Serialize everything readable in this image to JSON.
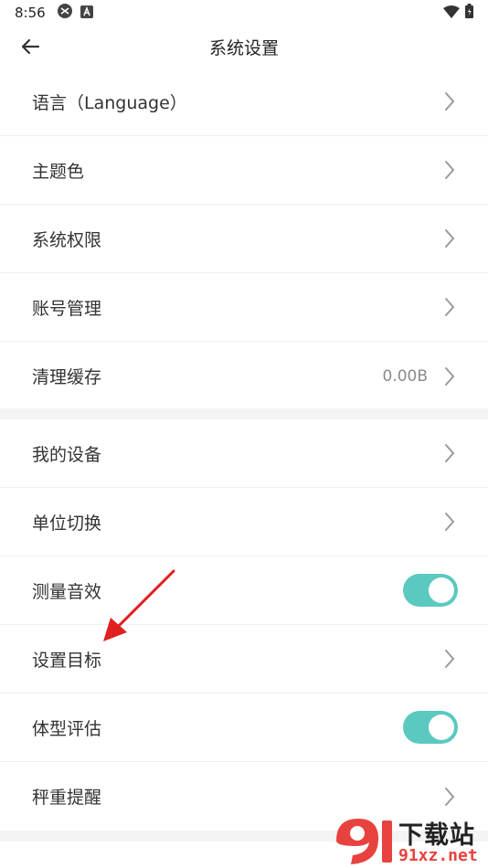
{
  "status_bar": {
    "time": "8:56"
  },
  "app_bar": {
    "title": "系统设置"
  },
  "group1": [
    {
      "label": "语言（Language）"
    },
    {
      "label": "主题色"
    },
    {
      "label": "系统权限"
    },
    {
      "label": "账号管理"
    },
    {
      "label": "清理缓存",
      "value": "0.00B"
    }
  ],
  "group2": [
    {
      "label": "我的设备"
    },
    {
      "label": "单位切换"
    },
    {
      "label": "测量音效",
      "toggle_on": true
    },
    {
      "label": "设置目标"
    },
    {
      "label": "体型评估",
      "toggle_on": true
    },
    {
      "label": "秤重提醒"
    }
  ],
  "colors": {
    "accent": "#5bc9c0",
    "annotation_arrow": "#e02020",
    "watermark_red": "#e8423f"
  },
  "watermark": {
    "title": "下载站",
    "domain": "91xz.net"
  }
}
